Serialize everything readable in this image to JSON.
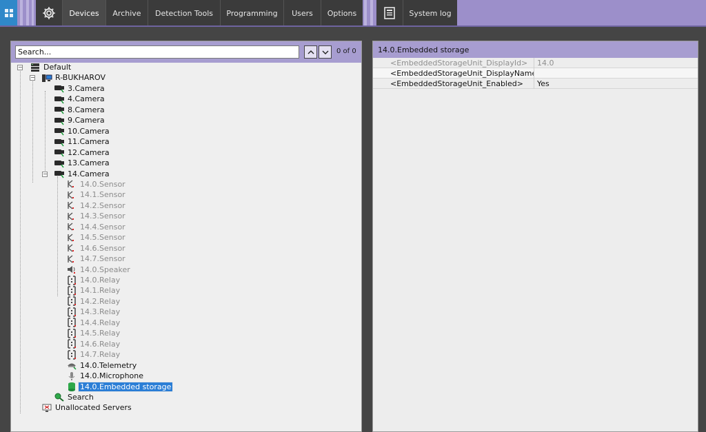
{
  "nav": {
    "tabs": [
      "Devices",
      "Archive",
      "Detection Tools",
      "Programming",
      "Users",
      "Options"
    ],
    "system_log": "System log"
  },
  "search": {
    "placeholder": "Search...",
    "counter": "0 of 0"
  },
  "tree": [
    {
      "label": "Default",
      "icon": "server-stack-icon",
      "dim": false
    },
    {
      "label": "R-BUKHAROV",
      "icon": "computer-icon",
      "dim": false
    },
    {
      "label": "3.Camera",
      "icon": "camera-icon",
      "dim": false
    },
    {
      "label": "4.Camera",
      "icon": "camera-icon",
      "dim": false
    },
    {
      "label": "8.Camera",
      "icon": "camera-icon",
      "dim": false
    },
    {
      "label": "9.Camera",
      "icon": "camera-icon",
      "dim": false
    },
    {
      "label": "10.Camera",
      "icon": "camera-icon",
      "dim": false
    },
    {
      "label": "11.Camera",
      "icon": "camera-icon",
      "dim": false
    },
    {
      "label": "12.Camera",
      "icon": "camera-icon",
      "dim": false
    },
    {
      "label": "13.Camera",
      "icon": "camera-icon",
      "dim": false
    },
    {
      "label": "14.Camera",
      "icon": "camera-icon",
      "dim": false
    },
    {
      "label": "14.0.Sensor",
      "icon": "sensor-icon",
      "dim": true
    },
    {
      "label": "14.1.Sensor",
      "icon": "sensor-icon",
      "dim": true
    },
    {
      "label": "14.2.Sensor",
      "icon": "sensor-icon",
      "dim": true
    },
    {
      "label": "14.3.Sensor",
      "icon": "sensor-icon",
      "dim": true
    },
    {
      "label": "14.4.Sensor",
      "icon": "sensor-icon",
      "dim": true
    },
    {
      "label": "14.5.Sensor",
      "icon": "sensor-icon",
      "dim": true
    },
    {
      "label": "14.6.Sensor",
      "icon": "sensor-icon",
      "dim": true
    },
    {
      "label": "14.7.Sensor",
      "icon": "sensor-icon",
      "dim": true
    },
    {
      "label": "14.0.Speaker",
      "icon": "speaker-icon",
      "dim": true
    },
    {
      "label": "14.0.Relay",
      "icon": "relay-icon",
      "dim": true
    },
    {
      "label": "14.1.Relay",
      "icon": "relay-icon",
      "dim": true
    },
    {
      "label": "14.2.Relay",
      "icon": "relay-icon",
      "dim": true
    },
    {
      "label": "14.3.Relay",
      "icon": "relay-icon",
      "dim": true
    },
    {
      "label": "14.4.Relay",
      "icon": "relay-icon",
      "dim": true
    },
    {
      "label": "14.5.Relay",
      "icon": "relay-icon",
      "dim": true
    },
    {
      "label": "14.6.Relay",
      "icon": "relay-icon",
      "dim": true
    },
    {
      "label": "14.7.Relay",
      "icon": "relay-icon",
      "dim": true
    },
    {
      "label": "14.0.Telemetry",
      "icon": "telemetry-icon",
      "dim": false
    },
    {
      "label": "14.0.Microphone",
      "icon": "microphone-icon",
      "dim": false
    },
    {
      "label": "14.0.Embedded storage",
      "icon": "storage-icon",
      "dim": false,
      "selected": true
    },
    {
      "label": "Search",
      "icon": "search-icon",
      "dim": false
    },
    {
      "label": "Unallocated Servers",
      "icon": "unallocated-server-icon",
      "dim": false
    }
  ],
  "properties": {
    "title": "14.0.Embedded storage",
    "rows": [
      {
        "key": "<EmbeddedStorageUnit_DisplayId>",
        "value": "14.0",
        "dim": true
      },
      {
        "key": "<EmbeddedStorageUnit_DisplayName>",
        "value": "",
        "dim": false
      },
      {
        "key": "<EmbeddedStorageUnit_Enabled>",
        "value": "Yes",
        "dim": false
      }
    ]
  },
  "colors": {
    "accent": "#9c8fca",
    "header": "#a79dd0",
    "selection": "#2b7ed6",
    "windows_button": "#2f88c9"
  }
}
